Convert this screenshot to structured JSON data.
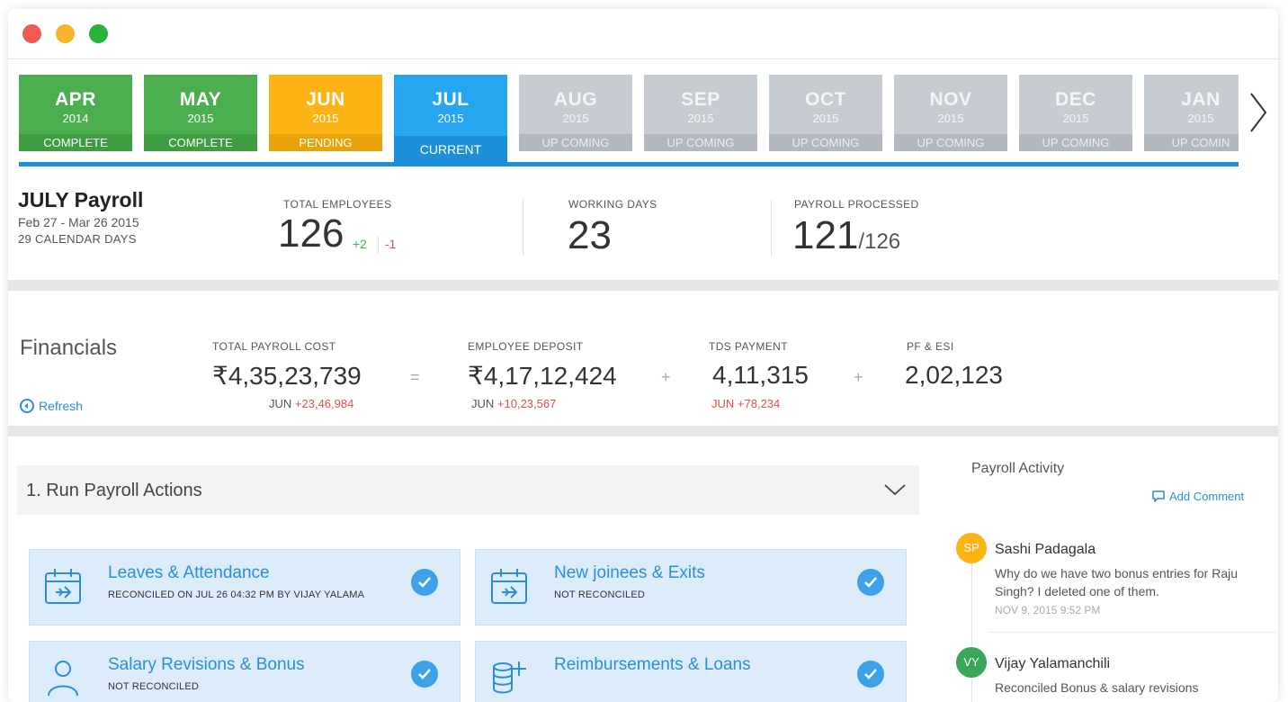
{
  "months": [
    {
      "month": "APR",
      "year": "2014",
      "status": "COMPLETE",
      "state": "complete"
    },
    {
      "month": "MAY",
      "year": "2015",
      "status": "COMPLETE",
      "state": "complete"
    },
    {
      "month": "JUN",
      "year": "2015",
      "status": "PENDING",
      "state": "pending"
    },
    {
      "month": "JUL",
      "year": "2015",
      "status": "CURRENT",
      "state": "current"
    },
    {
      "month": "AUG",
      "year": "2015",
      "status": "UP COMING",
      "state": "upcoming"
    },
    {
      "month": "SEP",
      "year": "2015",
      "status": "UP COMING",
      "state": "upcoming"
    },
    {
      "month": "OCT",
      "year": "2015",
      "status": "UP COMING",
      "state": "upcoming"
    },
    {
      "month": "NOV",
      "year": "2015",
      "status": "UP COMING",
      "state": "upcoming"
    },
    {
      "month": "DEC",
      "year": "2015",
      "status": "UP COMING",
      "state": "upcoming"
    },
    {
      "month": "JAN",
      "year": "2015",
      "status": "UP COMIN",
      "state": "upcoming"
    }
  ],
  "payroll": {
    "title": "JULY Payroll",
    "dates": "Feb 27 - Mar 26 2015",
    "calendar_days": "29 CALENDAR DAYS",
    "total_employees_label": "TOTAL EMPLOYEES",
    "total_employees": "126",
    "added": "+2",
    "removed": "-1",
    "working_days_label": "WORKING DAYS",
    "working_days": "23",
    "processed_label": "PAYROLL PROCESSED",
    "processed": "121",
    "processed_total": "/126"
  },
  "financials": {
    "title": "Financials",
    "refresh": "Refresh",
    "items": [
      {
        "label": "TOTAL PAYROLL COST",
        "value": "₹4,35,23,739",
        "sub_month": "JUN",
        "sub_delta": "+23,46,984"
      },
      {
        "label": "EMPLOYEE DEPOSIT",
        "value": "₹4,17,12,424",
        "sub_month": "JUN",
        "sub_delta": "+10,23,567"
      },
      {
        "label": "TDS PAYMENT",
        "value": "4,11,315",
        "sub_month": "JUN",
        "sub_delta": "+78,234"
      },
      {
        "label": "PF & ESI",
        "value": "2,02,123",
        "sub_month": "",
        "sub_delta": ""
      }
    ],
    "operators": [
      "=",
      "+",
      "+"
    ]
  },
  "actions": {
    "title": "1. Run Payroll Actions",
    "cards": [
      {
        "title": "Leaves & Attendance",
        "status": "RECONCILED ON JUL 26 04:32 PM BY VIJAY YALAMA",
        "icon": "calendar-plane-icon"
      },
      {
        "title": "New joinees & Exits",
        "status": "NOT RECONCILED",
        "icon": "calendar-plane-icon"
      },
      {
        "title": "Salary Revisions & Bonus",
        "status": "NOT RECONCILED",
        "icon": "person-icon"
      },
      {
        "title": "Reimbursements & Loans",
        "status": "",
        "icon": "coins-plus-icon"
      }
    ]
  },
  "activity": {
    "title": "Payroll Activity",
    "add_comment": "Add Comment",
    "entries": [
      {
        "initials": "SP",
        "name": "Sashi Padagala",
        "message": "Why do we have two bonus entries for Raju Singh? I deleted one of them.",
        "time": "NOV 9, 2015 9:52 PM",
        "color": "#fbb413"
      },
      {
        "initials": "VY",
        "name": "Vijay Yalamanchili",
        "message": "Reconciled Bonus & salary revisions",
        "time": "",
        "color": "#3aa757"
      }
    ]
  },
  "colors": {
    "complete": "#4bae4f",
    "pending": "#fbb413",
    "current": "#27a6f0",
    "upcoming": "#c7cbd2",
    "link": "#2a8fd6"
  }
}
